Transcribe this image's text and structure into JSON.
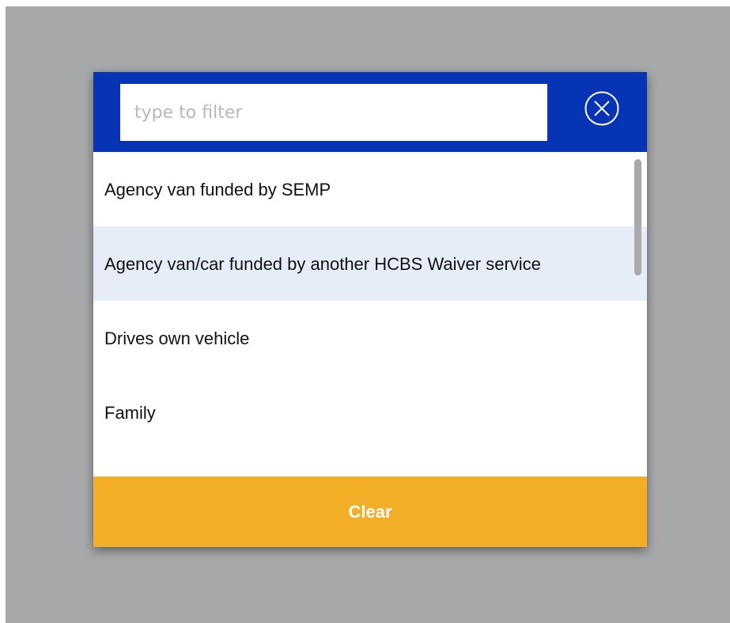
{
  "filter": {
    "placeholder": "type to filter",
    "value": ""
  },
  "header": {
    "close_icon": "close-circle-icon"
  },
  "list": {
    "items": [
      {
        "label": "Agency van funded by SEMP"
      },
      {
        "label": "Agency van/car funded by another HCBS Waiver service"
      },
      {
        "label": "Drives own vehicle"
      },
      {
        "label": "Family"
      }
    ],
    "highlighted_index": 1
  },
  "footer": {
    "clear_label": "Clear"
  },
  "colors": {
    "header_bg": "#0734b4",
    "clear_bg": "#f2ae27",
    "highlight_bg": "#e6edf8",
    "backdrop": "#a7a8aa"
  }
}
